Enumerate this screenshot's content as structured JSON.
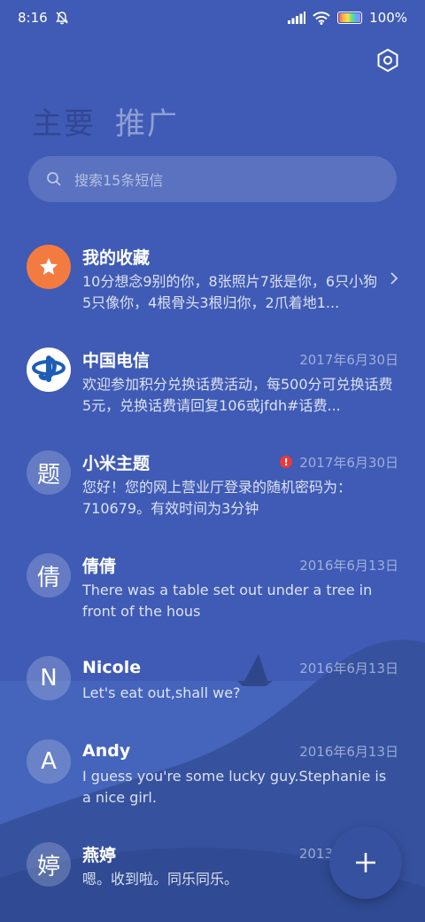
{
  "status_bar": {
    "time": "8:16",
    "battery": "100%"
  },
  "tabs": [
    {
      "label": "主要"
    },
    {
      "label": "推广"
    }
  ],
  "search": {
    "placeholder": "搜索15条短信"
  },
  "conversations": [
    {
      "name": "我的收藏",
      "date": "",
      "avatar": "star-icon",
      "preview": "10分想念9别的你，8张照片7张是你，6只小狗5只像你，4根骨头3根归你，2爪着地1..."
    },
    {
      "name": "中国电信",
      "date": "2017年6月30日",
      "avatar": "china-telecom-logo",
      "preview": "欢迎参加积分兑换话费活动，每500分可兑换话费5元，兑换话费请回复106或jfdh#话费..."
    },
    {
      "name": "小米主题",
      "date": "2017年6月30日",
      "avatar": "题",
      "preview": "您好！您的网上营业厅登录的随机密码为：710679。有效时间为3分钟"
    },
    {
      "name": "倩倩",
      "date": "2016年6月13日",
      "avatar": "倩",
      "preview": "There was a table set out under a tree in front of the hous"
    },
    {
      "name": "Nicole",
      "date": "2016年6月13日",
      "avatar": "N",
      "preview": "Let's eat out,shall we?"
    },
    {
      "name": "Andy",
      "date": "2016年6月13日",
      "avatar": "A",
      "preview": "I guess you're some lucky guy.Stephanie is a nice girl."
    },
    {
      "name": "燕婷",
      "date": "2013",
      "avatar": "婷",
      "preview": "嗯。收到啦。同乐同乐。"
    }
  ],
  "colors": {
    "background": "#3f5bb5",
    "accent_orange": "#f47b3f",
    "error_red": "#e83a3a"
  }
}
